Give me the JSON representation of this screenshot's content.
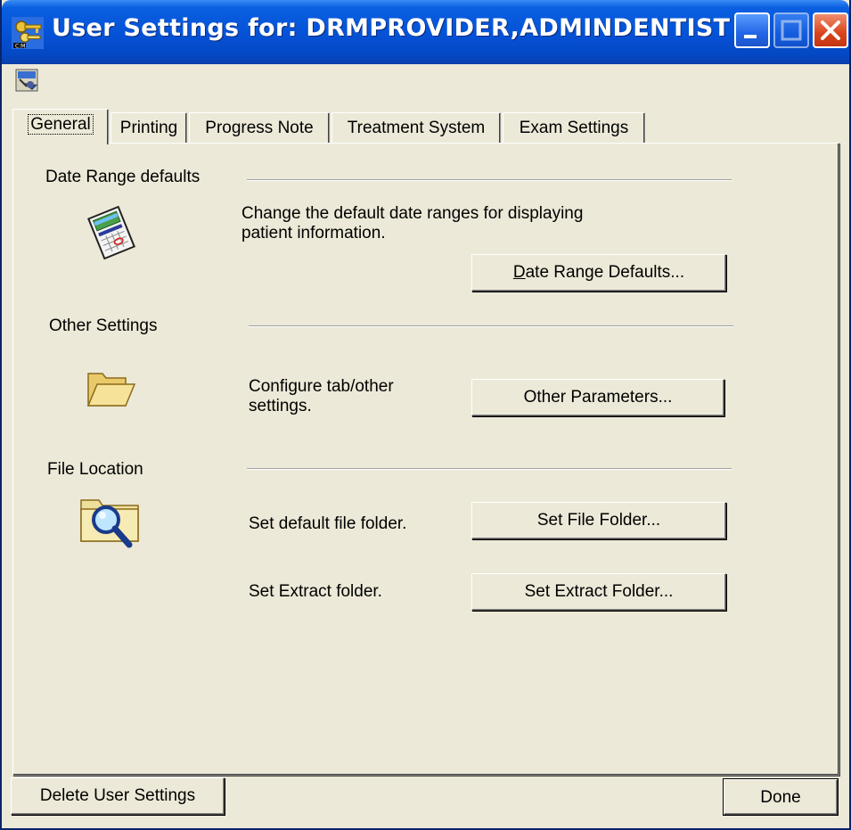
{
  "window": {
    "title": "User Settings for: DRMPROVIDER,ADMINDENTIST"
  },
  "tabs": [
    {
      "label": "General",
      "active": true
    },
    {
      "label": "Printing"
    },
    {
      "label": "Progress Note"
    },
    {
      "label": "Treatment System"
    },
    {
      "label": "Exam Settings"
    }
  ],
  "date_range": {
    "section_label": "Date Range defaults",
    "description_line1": "Change the default date ranges for displaying",
    "description_line2": "patient information.",
    "button_mnemonic": "D",
    "button_rest": "ate Range Defaults...",
    "icon": "calendar-icon"
  },
  "other_settings": {
    "section_label": "Other Settings",
    "description_line1": "Configure tab/other",
    "description_line2": "settings.",
    "button_label": "Other Parameters...",
    "icon": "folder-icon"
  },
  "file_location": {
    "section_label": "File Location",
    "file_folder_text": "Set default file folder.",
    "file_folder_button": "Set File Folder...",
    "extract_folder_text": "Set Extract folder.",
    "extract_folder_button": "Set Extract Folder...",
    "icon": "search-folder-icon"
  },
  "footer": {
    "delete_button": "Delete User Settings",
    "done_button": "Done"
  },
  "colors": {
    "titlebar": "#0553d8",
    "window_face": "#ece9d8",
    "close_button": "#d9431b"
  }
}
